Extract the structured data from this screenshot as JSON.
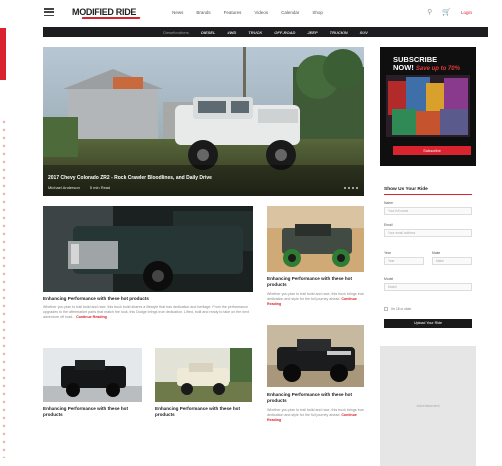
{
  "header": {
    "logo": "MODIFIED RIDE",
    "nav": [
      "News",
      "Brands",
      "Features",
      "Videos",
      "Calendar",
      "Shop"
    ],
    "account_label": "Login"
  },
  "brandbar": {
    "items": [
      "Dieselbrothers",
      "DIESEL",
      "4WD",
      "TRUCK",
      "OFF-ROAD",
      "JEEP",
      "TRUCKIN",
      "SUV"
    ]
  },
  "hero": {
    "title": "2017 Chevy Colorado ZR2 - Rock Crawler Bloodlines, and Daily Drive",
    "author": "Michael Anderson",
    "read_time": "5 min Read",
    "slide_count": 4
  },
  "articles": [
    {
      "title": "Enhancing Performance with these hot products",
      "text": "Whether you plan to trail build and race, this truck build shares a lifestyle that has dedication and heritage. From the performance upgrades to the aftermarket parts that match the look, this Dodge brings true dedication. Lifted, built and ready to take on the next adventure off road...",
      "read_more": "Continue Reading"
    },
    {
      "title": "Enhancing Performance with these hot products",
      "text": "Whether you plan to trail build and race, this truck brings true dedication and style for the full journey ahead.",
      "read_more": "Continue Reading"
    },
    {
      "title": "Enhancing Performance with these hot products",
      "text": "",
      "read_more": ""
    },
    {
      "title": "Enhancing Performance with these hot products",
      "text": "",
      "read_more": ""
    },
    {
      "title": "Enhancing Performance with these hot products",
      "text": "Whether you plan to trail build and race, this truck brings true dedication and style for the full journey ahead.",
      "read_more": "Continue Reading"
    }
  ],
  "subscribe": {
    "title_line1": "SUBSCRIBE",
    "title_line2": "NOW!",
    "title_accent": "Save up to 70%",
    "button": "Subscribe"
  },
  "form": {
    "title": "Show Us Your Ride",
    "fields": [
      {
        "label": "Name",
        "placeholder": "Your full name"
      },
      {
        "label": "Email",
        "placeholder": "Your email address"
      },
      {
        "label": "Year",
        "placeholder": "Year"
      },
      {
        "label": "Make",
        "placeholder": "Make"
      },
      {
        "label": "Model",
        "placeholder": "Model"
      }
    ],
    "checkbox_label": "I'm 18 or older",
    "submit": "Upload Your Ride"
  },
  "ad": {
    "label": "Advertisement"
  },
  "colors": {
    "accent": "#d9232e",
    "dark": "#1d1d1f"
  }
}
